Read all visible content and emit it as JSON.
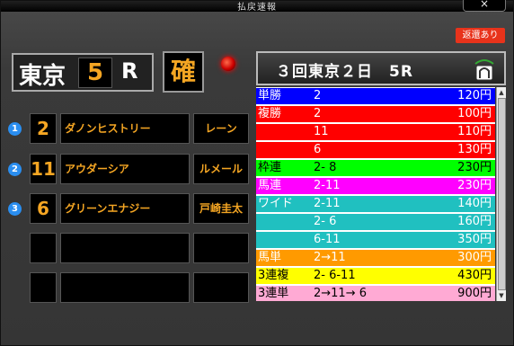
{
  "window": {
    "title": "払戻速報",
    "close_label": "×"
  },
  "refund_badge": "返還あり",
  "race_box": {
    "venue": "東京",
    "race_number": "5",
    "race_label": "R",
    "confirmed": "確"
  },
  "results": [
    {
      "rank": "1",
      "number": "2",
      "horse": "ダノンヒストリー",
      "jockey": "レーン"
    },
    {
      "rank": "2",
      "number": "11",
      "horse": "アウダーシア",
      "jockey": "ルメール"
    },
    {
      "rank": "3",
      "number": "6",
      "horse": "グリーンエナジー",
      "jockey": "戸崎圭太"
    },
    {
      "rank": "",
      "number": "",
      "horse": "",
      "jockey": ""
    },
    {
      "rank": "",
      "number": "",
      "horse": "",
      "jockey": ""
    }
  ],
  "race_header": "３回東京２日　5R",
  "payouts": [
    {
      "type": "単勝",
      "combo": "2",
      "payout": "120円",
      "bg": "#0000ff",
      "fg": "#ffffff"
    },
    {
      "type": "複勝",
      "combo": "2",
      "payout": "100円",
      "bg": "#ff0000",
      "fg": "#ffffff"
    },
    {
      "type": "",
      "combo": "11",
      "payout": "110円",
      "bg": "#ff0000",
      "fg": "#ffffff"
    },
    {
      "type": "",
      "combo": "6",
      "payout": "130円",
      "bg": "#ff0000",
      "fg": "#ffffff"
    },
    {
      "type": "枠連",
      "combo": "2- 8",
      "payout": "230円",
      "bg": "#00ff00",
      "fg": "#000000"
    },
    {
      "type": "馬連",
      "combo": "2-11",
      "payout": "230円",
      "bg": "#ff00ff",
      "fg": "#ffffff"
    },
    {
      "type": "ワイド",
      "combo": "2-11",
      "payout": "140円",
      "bg": "#20c0c0",
      "fg": "#ffffff"
    },
    {
      "type": "",
      "combo": "2- 6",
      "payout": "160円",
      "bg": "#20c0c0",
      "fg": "#ffffff"
    },
    {
      "type": "",
      "combo": "6-11",
      "payout": "350円",
      "bg": "#20c0c0",
      "fg": "#ffffff"
    },
    {
      "type": "馬単",
      "combo": "2→11",
      "payout": "300円",
      "bg": "#ff9a00",
      "fg": "#ffffff"
    },
    {
      "type": "3連複",
      "combo": "2- 6-11",
      "payout": "430円",
      "bg": "#ffff00",
      "fg": "#000000"
    },
    {
      "type": "3連単",
      "combo": "2→11→ 6",
      "payout": "900円",
      "bg": "#ffaad4",
      "fg": "#000000"
    }
  ],
  "scrollbar": {
    "up": "▲",
    "down": "▼"
  }
}
